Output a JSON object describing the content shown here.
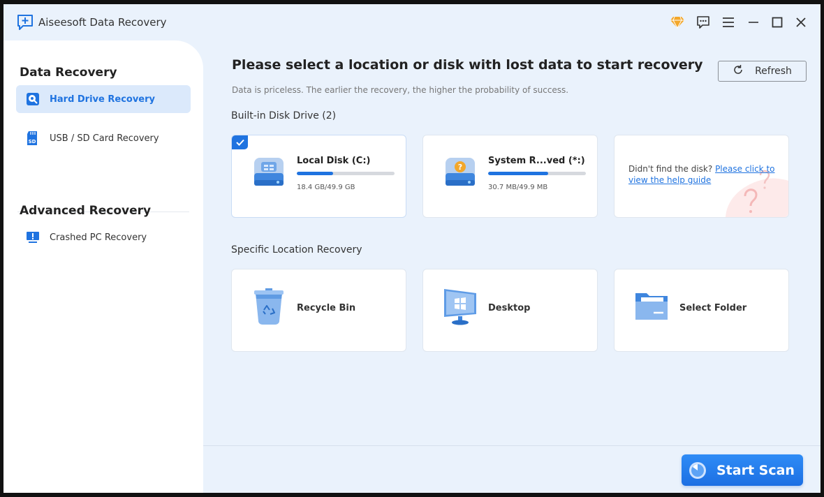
{
  "app": {
    "title": "Aiseesoft Data Recovery"
  },
  "titlebar": {
    "icons": [
      "diamond-icon",
      "feedback-icon",
      "menu-icon",
      "minimize-icon",
      "maximize-icon",
      "close-icon"
    ]
  },
  "sidebar": {
    "sections": [
      {
        "heading": "Data Recovery",
        "items": [
          {
            "label": "Hard Drive Recovery",
            "icon": "hard-drive-icon",
            "active": true
          },
          {
            "label": "USB / SD Card Recovery",
            "icon": "sd-card-icon",
            "active": false
          }
        ]
      },
      {
        "heading": "Advanced Recovery",
        "items": [
          {
            "label": "Crashed PC Recovery",
            "icon": "crashed-pc-icon",
            "active": false
          }
        ]
      }
    ]
  },
  "main": {
    "title": "Please select a location or disk with lost data to start recovery",
    "subtitle": "Data is priceless. The earlier the recovery, the higher the probability of success.",
    "refresh_label": "Refresh",
    "builtin_title": "Built-in Disk Drive (2)",
    "disks": [
      {
        "name": "Local Disk (C:)",
        "size": "18.4 GB/49.9 GB",
        "used_fraction": 0.37,
        "selected": true
      },
      {
        "name": "System R...ved (*:)",
        "size": "30.7 MB/49.9 MB",
        "used_fraction": 0.615,
        "selected": false
      }
    ],
    "help": {
      "text": "Didn't find the disk? ",
      "link": "Please click to view the help guide"
    },
    "specific_title": "Specific Location Recovery",
    "locations": [
      {
        "label": "Recycle Bin",
        "icon": "recycle-bin-icon"
      },
      {
        "label": "Desktop",
        "icon": "desktop-icon"
      },
      {
        "label": "Select Folder",
        "icon": "folder-icon"
      }
    ],
    "start_scan_label": "Start Scan"
  },
  "colors": {
    "accent": "#1f73e0",
    "background": "#eaf2fc",
    "sidebar": "#ffffff"
  }
}
